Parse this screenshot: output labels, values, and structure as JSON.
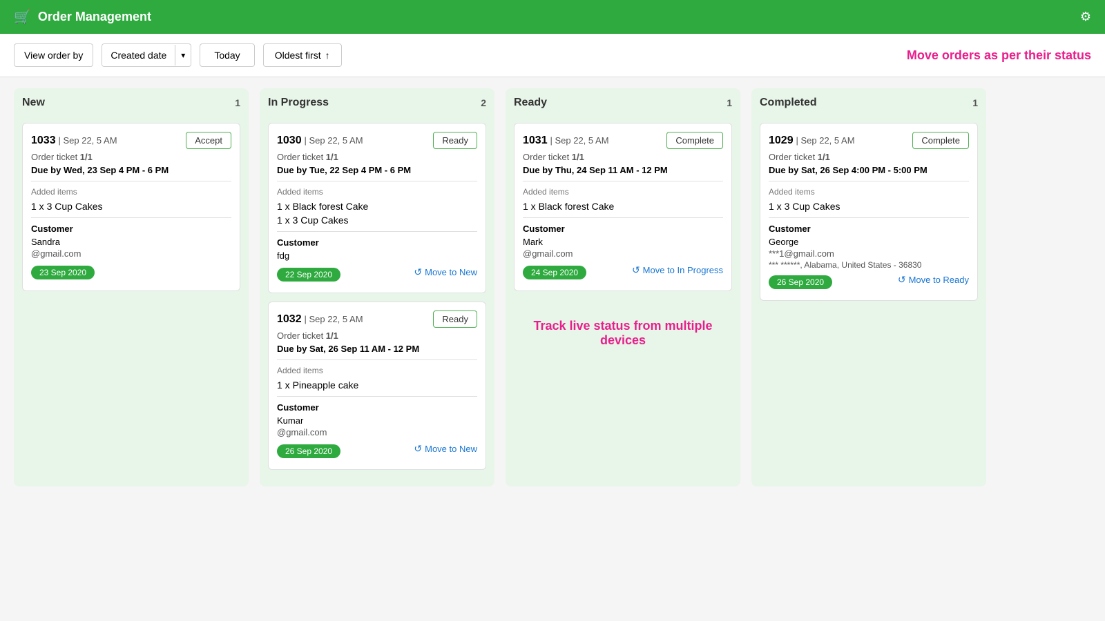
{
  "header": {
    "title": "Order Management",
    "icon": "🛒",
    "gear_icon": "⚙"
  },
  "toolbar": {
    "view_order_by_label": "View order by",
    "created_date_label": "Created date",
    "dropdown_arrow": "▾",
    "today_label": "Today",
    "oldest_first_label": "Oldest first",
    "sort_arrow": "↑",
    "promo_text": "Move orders as per their status"
  },
  "columns": [
    {
      "id": "new",
      "title": "New",
      "count": 1,
      "cards": [
        {
          "order_num": "1033",
          "date": "Sep 22, 5 AM",
          "ticket": "1/1",
          "due": "Due by Wed, 23 Sep 4 PM - 6 PM",
          "action_label": "Accept",
          "items": [
            "1 x 3 Cup Cakes"
          ],
          "customer_name": "Sandra",
          "customer_email": "@gmail.com",
          "customer_address": "",
          "date_badge": "23 Sep 2020",
          "move_label": ""
        }
      ]
    },
    {
      "id": "in_progress",
      "title": "In Progress",
      "count": 2,
      "cards": [
        {
          "order_num": "1030",
          "date": "Sep 22, 5 AM",
          "ticket": "1/1",
          "due": "Due by Tue, 22 Sep 4 PM - 6 PM",
          "action_label": "Ready",
          "items": [
            "1 x Black forest Cake",
            "1 x 3 Cup Cakes"
          ],
          "customer_name": "fdg",
          "customer_email": "",
          "customer_address": "",
          "date_badge": "22 Sep 2020",
          "move_label": "Move to New"
        },
        {
          "order_num": "1032",
          "date": "Sep 22, 5 AM",
          "ticket": "1/1",
          "due": "Due by Sat, 26 Sep 11 AM - 12 PM",
          "action_label": "Ready",
          "items": [
            "1 x Pineapple cake"
          ],
          "customer_name": "Kumar",
          "customer_email": "@gmail.com",
          "customer_address": "",
          "date_badge": "26 Sep 2020",
          "move_label": "Move to New"
        }
      ]
    },
    {
      "id": "ready",
      "title": "Ready",
      "count": 1,
      "cards": [
        {
          "order_num": "1031",
          "date": "Sep 22, 5 AM",
          "ticket": "1/1",
          "due": "Due by Thu, 24 Sep 11 AM - 12 PM",
          "action_label": "Complete",
          "items": [
            "1 x Black forest Cake"
          ],
          "customer_name": "Mark",
          "customer_email": "@gmail.com",
          "customer_address": "",
          "date_badge": "24 Sep 2020",
          "move_label": "Move to In Progress"
        }
      ]
    },
    {
      "id": "completed",
      "title": "Completed",
      "count": 1,
      "cards": [
        {
          "order_num": "1029",
          "date": "Sep 22, 5 AM",
          "ticket": "1/1",
          "due": "Due by Sat, 26 Sep 4:00 PM - 5:00 PM",
          "action_label": "Complete",
          "items": [
            "1 x 3 Cup Cakes"
          ],
          "customer_name": "George",
          "customer_email": "***1@gmail.com",
          "customer_address": "*** ******, Alabama, United States - 36830",
          "date_badge": "26 Sep 2020",
          "move_label": "Move to Ready"
        }
      ]
    }
  ],
  "promo_bottom": "Track live status from multiple devices"
}
